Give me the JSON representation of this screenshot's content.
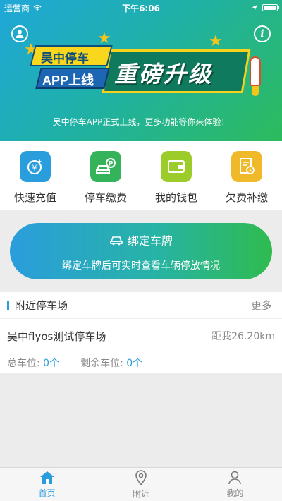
{
  "status_bar": {
    "carrier": "运营商",
    "time": "下午6:06"
  },
  "banner": {
    "ribbon_line1": "吴中停车",
    "ribbon_line2": "APP上线",
    "headline": "重磅升级",
    "subtitle": "吴中停车APP正式上线，更多功能等你来体验！"
  },
  "actions": [
    {
      "label": "快速充值",
      "icon": "yuan-recharge-icon",
      "color": "#2a9ddc"
    },
    {
      "label": "停车缴费",
      "icon": "car-parking-icon",
      "color": "#35b35a"
    },
    {
      "label": "我的钱包",
      "icon": "wallet-icon",
      "color": "#9ccc2a"
    },
    {
      "label": "欠费补缴",
      "icon": "bill-icon",
      "color": "#f0b92a"
    }
  ],
  "bind_card": {
    "title": "绑定车牌",
    "description": "绑定车牌后可实时查看车辆停放情况"
  },
  "nearby": {
    "title": "附近停车场",
    "more": "更多",
    "lot": {
      "name": "吴中flyos测试停车场",
      "distance": "距我26.20km",
      "total_label": "总车位:",
      "total_value": "0个",
      "free_label": "剩余车位:",
      "free_value": "0个"
    }
  },
  "tabs": [
    {
      "label": "首页",
      "icon": "home-icon",
      "active": true
    },
    {
      "label": "附近",
      "icon": "location-pin-icon",
      "active": false
    },
    {
      "label": "我的",
      "icon": "person-icon",
      "active": false
    }
  ],
  "colors": {
    "accent": "#2a9ddc",
    "green": "#2fbb4f"
  }
}
